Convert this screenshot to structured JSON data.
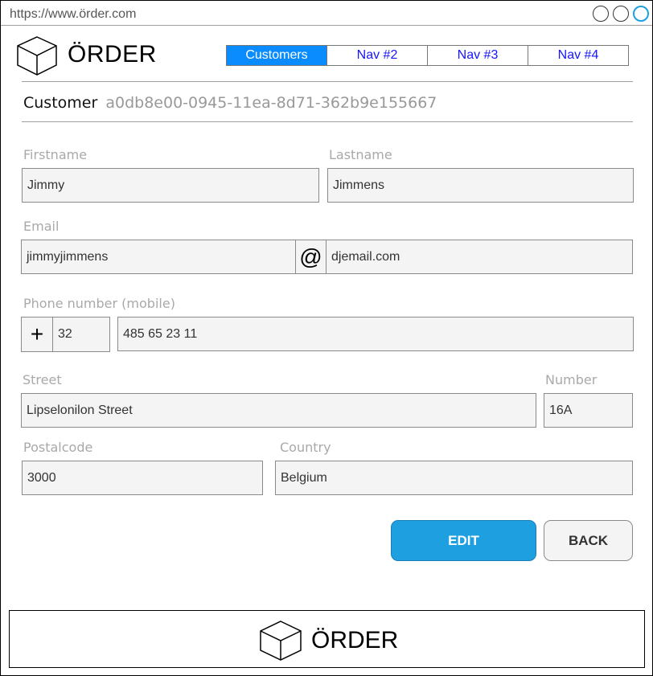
{
  "browser": {
    "url": "https://www.örder.com"
  },
  "header": {
    "brand": "ÖRDER",
    "nav": [
      {
        "label": "Customers",
        "active": true
      },
      {
        "label": "Nav #2",
        "active": false
      },
      {
        "label": "Nav #3",
        "active": false
      },
      {
        "label": "Nav #4",
        "active": false
      }
    ]
  },
  "customer": {
    "label": "Customer",
    "id": "a0db8e00-0945-11ea-8d71-362b9e155667"
  },
  "form": {
    "firstname": {
      "label": "Firstname",
      "value": "Jimmy"
    },
    "lastname": {
      "label": "Lastname",
      "value": "Jimmens"
    },
    "email": {
      "label": "Email",
      "user": "jimmyjimmens",
      "at": "@",
      "domain": "djemail.com"
    },
    "phone": {
      "label": "Phone number (mobile)",
      "plus": "+",
      "country_code": "32",
      "number": "485 65 23 11"
    },
    "street": {
      "label": "Street",
      "value": "Lipselonilon Street"
    },
    "number": {
      "label": "Number",
      "value": "16A"
    },
    "postalcode": {
      "label": "Postalcode",
      "value": "3000"
    },
    "country": {
      "label": "Country",
      "value": "Belgium"
    }
  },
  "actions": {
    "edit": "EDIT",
    "back": "BACK"
  },
  "footer": {
    "brand": "ÖRDER"
  },
  "colors": {
    "accent": "#1ea0e0",
    "nav_active": "#0a8cff",
    "nav_link": "#1515ff",
    "label": "#a9a9a9",
    "field_bg": "#f4f4f4"
  }
}
